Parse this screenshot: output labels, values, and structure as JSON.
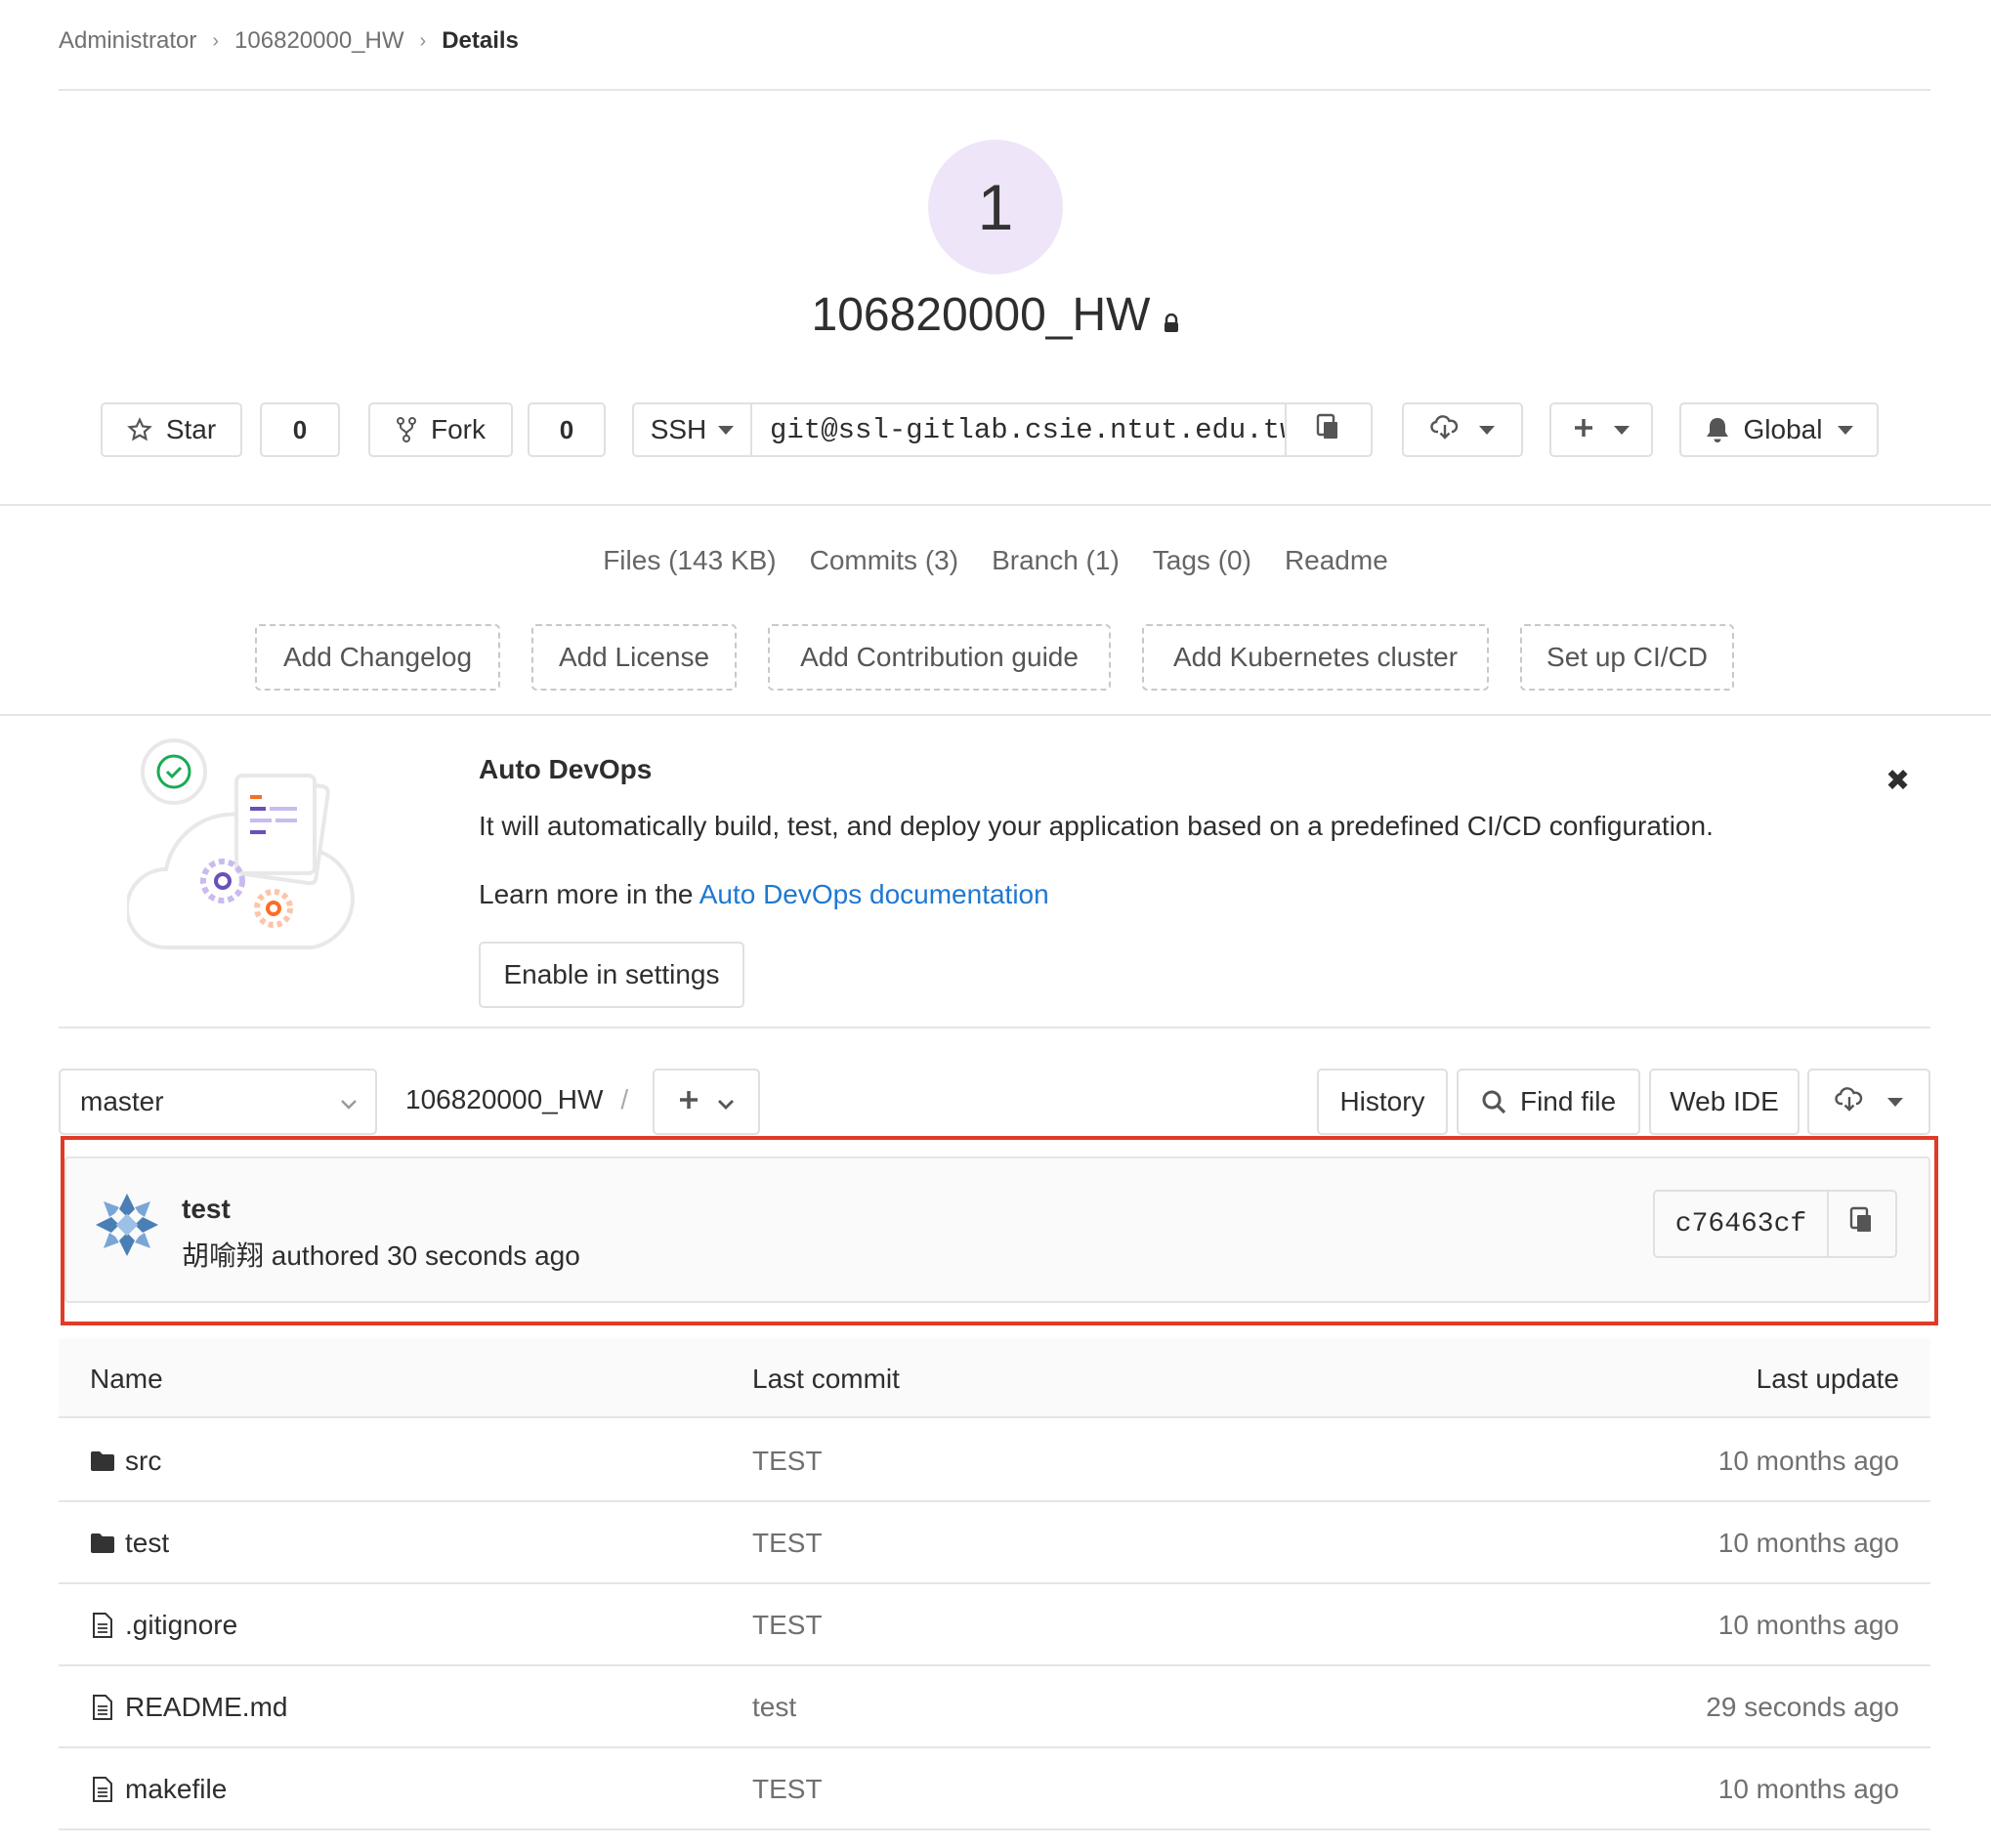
{
  "breadcrumb": {
    "items": [
      "Administrator",
      "106820000_HW"
    ],
    "current": "Details"
  },
  "project": {
    "avatar_letter": "1",
    "name": "106820000_HW"
  },
  "actions": {
    "star_label": "Star",
    "star_count": "0",
    "fork_label": "Fork",
    "fork_count": "0",
    "protocol_label": "SSH",
    "clone_url": "git@ssl-gitlab.csie.ntut.edu.tw",
    "notification_label": "Global"
  },
  "stats": [
    "Files (143 KB)",
    "Commits (3)",
    "Branch (1)",
    "Tags (0)",
    "Readme"
  ],
  "quick_links": [
    "Add Changelog",
    "Add License",
    "Add Contribution guide",
    "Add Kubernetes cluster",
    "Set up CI/CD"
  ],
  "auto_devops": {
    "title": "Auto DevOps",
    "text": "It will automatically build, test, and deploy your application based on a predefined CI/CD configuration.",
    "learn_prefix": "Learn more in the",
    "learn_link": "Auto DevOps documentation",
    "button": "Enable in settings"
  },
  "repo_nav": {
    "branch": "master",
    "path": "106820000_HW",
    "path_sep": "/",
    "history": "History",
    "find_file": "Find file",
    "web_ide": "Web IDE"
  },
  "last_commit": {
    "title": "test",
    "author_line": "胡喻翔 authored 30 seconds ago",
    "sha": "c76463cf"
  },
  "table": {
    "headers": {
      "name": "Name",
      "last_commit": "Last commit",
      "last_update": "Last update"
    },
    "rows": [
      {
        "icon": "folder-icon",
        "name": "src",
        "commit": "TEST",
        "update": "10 months ago"
      },
      {
        "icon": "folder-icon",
        "name": "test",
        "commit": "TEST",
        "update": "10 months ago"
      },
      {
        "icon": "file-icon",
        "name": ".gitignore",
        "commit": "TEST",
        "update": "10 months ago"
      },
      {
        "icon": "file-icon",
        "name": "README.md",
        "commit": "test",
        "update": "29 seconds ago"
      },
      {
        "icon": "file-icon",
        "name": "makefile",
        "commit": "TEST",
        "update": "10 months ago"
      }
    ]
  },
  "colors": {
    "link": "#1f78d1",
    "highlight_frame": "#e03a28",
    "avatar_bg": "#eee5f8"
  }
}
